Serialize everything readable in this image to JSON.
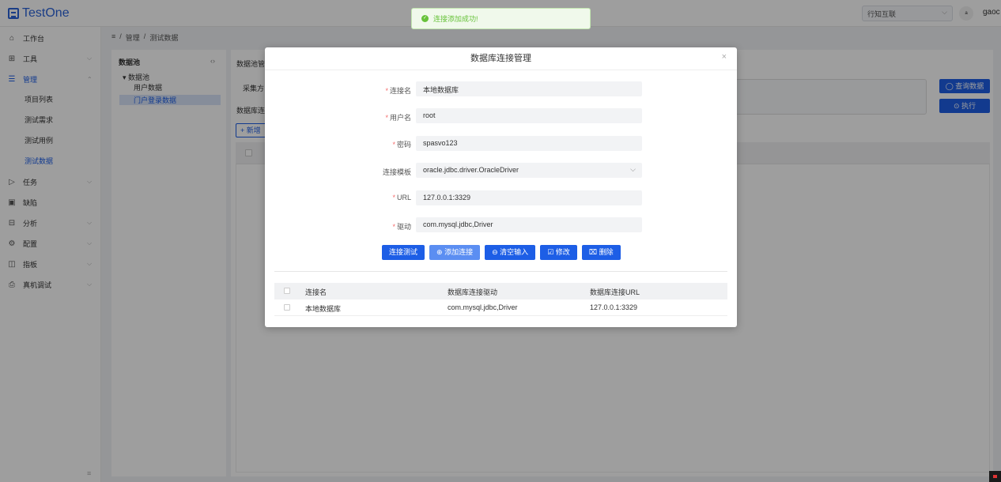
{
  "header": {
    "app_name": "TestOne",
    "org_select": "行知互联",
    "translate_label": "ᵃ",
    "user_name": "gaoc"
  },
  "sidebar": {
    "items": [
      {
        "label": "工作台",
        "icon": "home-icon",
        "glyph": "⌂"
      },
      {
        "label": "工具",
        "icon": "grid-icon",
        "glyph": "⊞"
      },
      {
        "label": "管理",
        "icon": "list-icon",
        "glyph": "☰"
      },
      {
        "label": "任务",
        "icon": "send-icon",
        "glyph": "▷"
      },
      {
        "label": "缺陷",
        "icon": "bug-icon",
        "glyph": "▣"
      },
      {
        "label": "分析",
        "icon": "chart-icon",
        "glyph": "⊟"
      },
      {
        "label": "配置",
        "icon": "gear-icon",
        "glyph": "⚙"
      },
      {
        "label": "指板",
        "icon": "board-icon",
        "glyph": "◫"
      },
      {
        "label": "真机调试",
        "icon": "device-icon",
        "glyph": "⎙"
      }
    ],
    "sub_items": [
      "项目列表",
      "测试需求",
      "测试用例",
      "测试数据"
    ]
  },
  "breadcrumb": {
    "items": [
      "管理",
      "测试数据"
    ],
    "separator": "/"
  },
  "pool": {
    "title": "数据池",
    "tree_root": "数据池",
    "tree_children": [
      "用户数据",
      "门户登录数据"
    ]
  },
  "main": {
    "label_manage": "数据池管",
    "label_collect": "采集方",
    "label_conn": "数据库连",
    "add_label": "新增",
    "query_button": "查询数据",
    "execute_button": "执行"
  },
  "dialog": {
    "title": "数据库连接管理",
    "fields": [
      {
        "label": "连接名",
        "required": true,
        "value": "本地数据库"
      },
      {
        "label": "用户名",
        "required": true,
        "value": "root"
      },
      {
        "label": "密码",
        "required": true,
        "value": "spasvo123"
      },
      {
        "label": "连接模板",
        "required": false,
        "value": "oracle.jdbc.driver.OracleDriver"
      },
      {
        "label": "URL",
        "required": true,
        "value": "127.0.0.1:3329"
      },
      {
        "label": "驱动",
        "required": true,
        "value": "com.mysql.jdbc,Driver"
      }
    ],
    "buttons": {
      "test": "连接测试",
      "add": "添加连接",
      "clear": "清空输入",
      "edit": "修改",
      "delete": "删除"
    },
    "table": {
      "headers": [
        "连接名",
        "数据库连接驱动",
        "数据库连接URL"
      ],
      "rows": [
        [
          "本地数据库",
          "com.mysql.jdbc,Driver",
          "127.0.0.1:3329"
        ]
      ]
    }
  },
  "toast": {
    "message": "连接添加成功!"
  },
  "colors": {
    "primary": "#1d5ee6",
    "success": "#67c23a",
    "danger": "#f56c6c"
  }
}
